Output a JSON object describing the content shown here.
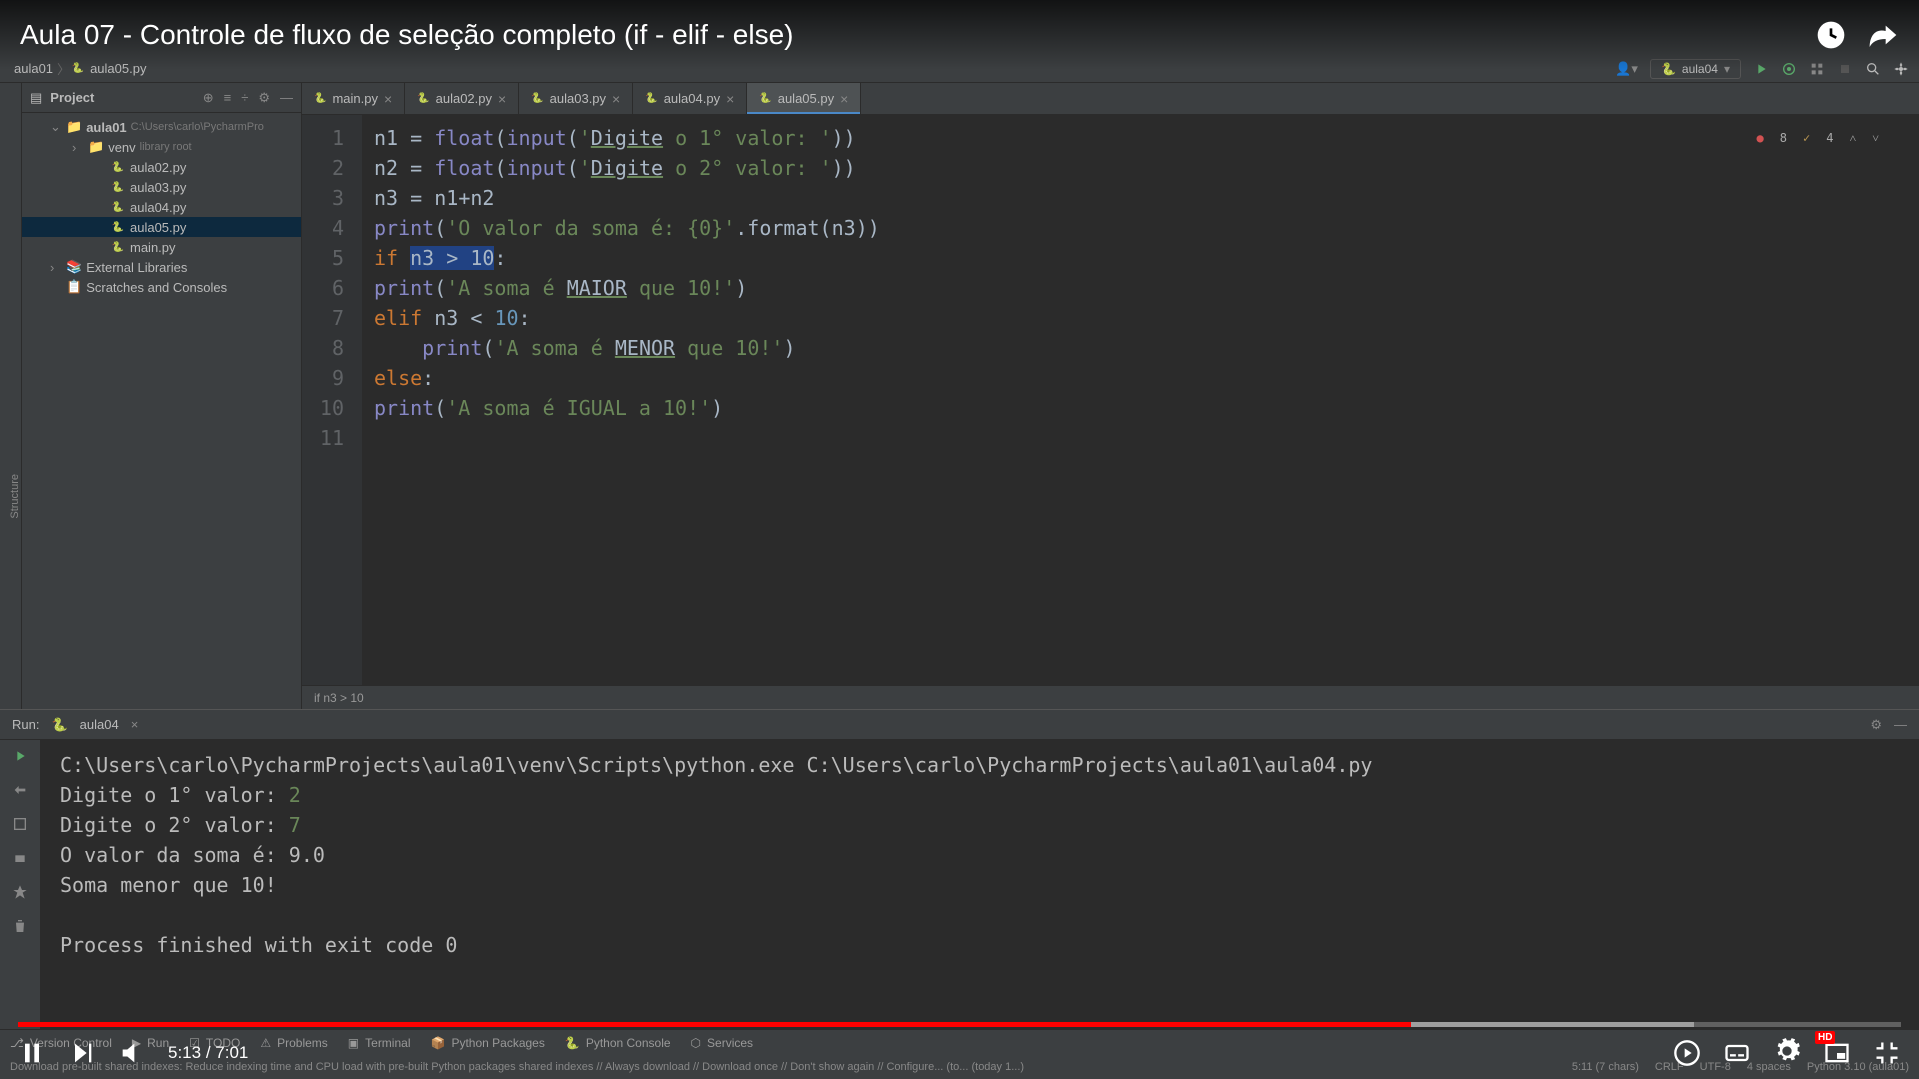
{
  "video": {
    "title": "Aula 07 - Controle de fluxo de seleção completo (if - elif - else)",
    "current_time": "5:13",
    "duration": "7:01",
    "played_pct": 74,
    "loaded_pct": 89
  },
  "breadcrumb": {
    "project": "aula01",
    "file": "aula05.py"
  },
  "run_config": "aula04",
  "project_panel": {
    "title": "Project",
    "root_name": "aula01",
    "root_path": "C:\\Users\\carlo\\PycharmPro",
    "venv": "venv",
    "venv_hint": "library root",
    "files": [
      "aula02.py",
      "aula03.py",
      "aula04.py",
      "aula05.py",
      "main.py"
    ],
    "external": "External Libraries",
    "scratches": "Scratches and Consoles"
  },
  "tabs": [
    {
      "label": "main.py",
      "active": false
    },
    {
      "label": "aula02.py",
      "active": false
    },
    {
      "label": "aula03.py",
      "active": false
    },
    {
      "label": "aula04.py",
      "active": false
    },
    {
      "label": "aula05.py",
      "active": true
    }
  ],
  "code": {
    "lines": [
      {
        "n": 1,
        "tokens": [
          [
            "ident",
            "n1 "
          ],
          [
            "op",
            "= "
          ],
          [
            "builtin",
            "float"
          ],
          [
            "op",
            "("
          ],
          [
            "builtin",
            "input"
          ],
          [
            "op",
            "("
          ],
          [
            "str",
            "'"
          ],
          [
            "underline",
            "Digite"
          ],
          [
            "str",
            " o 1° valor: '"
          ],
          [
            "op",
            "))"
          ]
        ]
      },
      {
        "n": 2,
        "tokens": [
          [
            "ident",
            "n2 "
          ],
          [
            "op",
            "= "
          ],
          [
            "builtin",
            "float"
          ],
          [
            "op",
            "("
          ],
          [
            "builtin",
            "input"
          ],
          [
            "op",
            "("
          ],
          [
            "str",
            "'"
          ],
          [
            "underline",
            "Digite"
          ],
          [
            "str",
            " o 2° valor: '"
          ],
          [
            "op",
            "))"
          ]
        ]
      },
      {
        "n": 3,
        "tokens": [
          [
            "ident",
            "n3 "
          ],
          [
            "op",
            "= "
          ],
          [
            "ident",
            "n1"
          ],
          [
            "op",
            "+"
          ],
          [
            "ident",
            "n2"
          ]
        ]
      },
      {
        "n": 4,
        "tokens": [
          [
            "builtin",
            "print"
          ],
          [
            "op",
            "("
          ],
          [
            "str",
            "'O valor da soma é: {0}'"
          ],
          [
            "op",
            "."
          ],
          [
            "ident",
            "format"
          ],
          [
            "op",
            "("
          ],
          [
            "ident",
            "n3"
          ],
          [
            "op",
            "))"
          ]
        ]
      },
      {
        "n": 5,
        "tokens": [
          [
            "kw",
            "if "
          ],
          [
            "sel",
            "n3 > 10"
          ],
          [
            "op",
            ":"
          ]
        ]
      },
      {
        "n": 6,
        "tokens": [
          [
            "builtin",
            "print"
          ],
          [
            "op",
            "("
          ],
          [
            "str",
            "'A soma é "
          ],
          [
            "underline",
            "MAIOR"
          ],
          [
            "str",
            " que 10!'"
          ],
          [
            "op",
            ")"
          ]
        ]
      },
      {
        "n": 7,
        "tokens": [
          [
            "kw",
            "elif "
          ],
          [
            "ident",
            "n3 "
          ],
          [
            "op",
            "< "
          ],
          [
            "num",
            "10"
          ],
          [
            "op",
            ":"
          ]
        ]
      },
      {
        "n": 8,
        "tokens": [
          [
            "ident",
            "    "
          ],
          [
            "builtin",
            "print"
          ],
          [
            "op",
            "("
          ],
          [
            "str",
            "'A soma é "
          ],
          [
            "underline",
            "MENOR"
          ],
          [
            "str",
            " que 10!'"
          ],
          [
            "op",
            ")"
          ]
        ]
      },
      {
        "n": 9,
        "tokens": [
          [
            "kw",
            "else"
          ],
          [
            "op",
            ":"
          ]
        ]
      },
      {
        "n": 10,
        "tokens": [
          [
            "builtin",
            "print"
          ],
          [
            "op",
            "("
          ],
          [
            "str",
            "'A soma é IGUAL a 10!'"
          ],
          [
            "op",
            ")"
          ]
        ]
      },
      {
        "n": 11,
        "tokens": []
      }
    ],
    "breadcrumb": "if n3 > 10",
    "errors": "8",
    "warnings": "4"
  },
  "run_panel": {
    "title": "Run:",
    "config": "aula04",
    "path_line": "C:\\Users\\carlo\\PycharmProjects\\aula01\\venv\\Scripts\\python.exe C:\\Users\\carlo\\PycharmProjects\\aula01\\aula04.py",
    "lines": [
      {
        "text": "Digite o 1° valor: ",
        "input": "2"
      },
      {
        "text": "Digite o 2° valor: ",
        "input": "7"
      },
      {
        "text": "O valor da soma é: 9.0"
      },
      {
        "text": "Soma menor que 10!"
      },
      {
        "text": ""
      },
      {
        "text": "Process finished with exit code 0"
      }
    ]
  },
  "bottom_tabs": [
    "Version Control",
    "Run",
    "TODO",
    "Problems",
    "Terminal",
    "Python Packages",
    "Python Console",
    "Services"
  ],
  "status_bar": {
    "left": "Download pre-built shared indexes: Reduce indexing time and CPU load with pre-built Python packages shared indexes // Always download // Download once // Don't show again // Configure... (to... (today 1...)",
    "pos": "5:11 (7 chars)",
    "enc": "CRLF",
    "charset": "UTF-8",
    "spaces": "4 spaces",
    "python": "Python 3.10 (aula01)"
  }
}
